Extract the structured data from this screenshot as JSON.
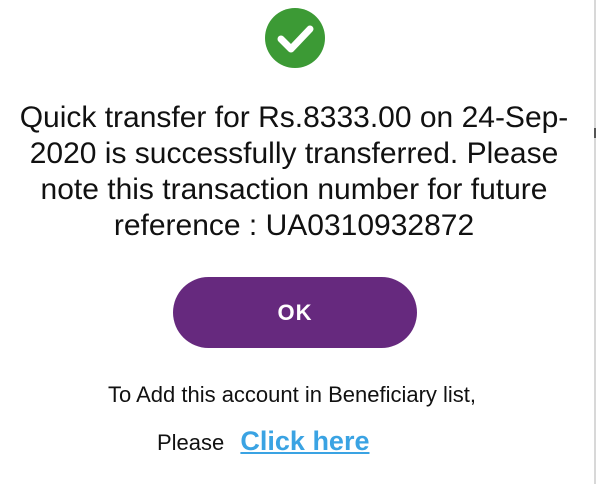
{
  "dialog": {
    "icon": "check-circle-icon",
    "message": "Quick transfer for Rs.8333.00 on 24-Sep-2020 is successfully transferred. Please note this transaction number for future reference : UA0310932872",
    "ok_label": "OK",
    "add_beneficiary_text": "To Add this account in Beneficiary list,",
    "please_text": "Please",
    "link_label": "Click here"
  },
  "colors": {
    "success_icon": "#3c9a35",
    "button": "#66297e",
    "link": "#3aa3e3"
  }
}
